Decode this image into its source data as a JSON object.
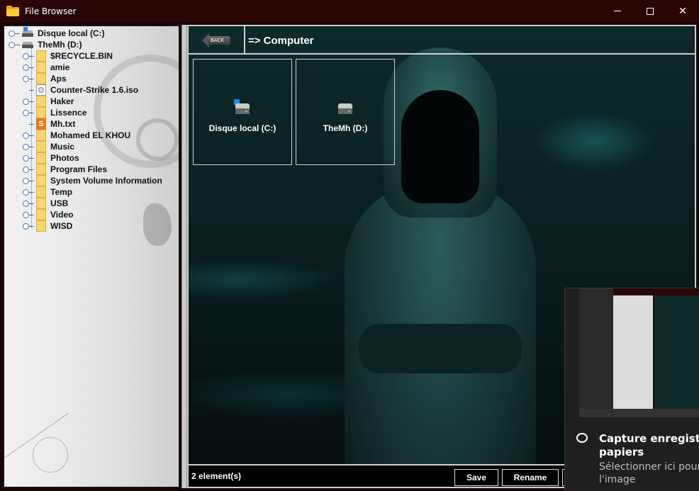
{
  "window": {
    "title": "File Browser",
    "minimize": "minimize",
    "maximize": "maximize",
    "close": "✕"
  },
  "tree": {
    "drives": [
      {
        "label": "Disque local (C:)"
      },
      {
        "label": "TheMh (D:)"
      }
    ],
    "children": [
      {
        "label": "$RECYCLE.BIN",
        "icon": "folder-icon"
      },
      {
        "label": "amie",
        "icon": "folder-icon"
      },
      {
        "label": "Aps",
        "icon": "folder-icon"
      },
      {
        "label": "Counter-Strike 1.6.iso",
        "icon": "iso-file-icon"
      },
      {
        "label": "Haker",
        "icon": "folder-icon"
      },
      {
        "label": "Lissence",
        "icon": "folder-icon"
      },
      {
        "label": "Mh.txt",
        "icon": "text-file-icon"
      },
      {
        "label": "Mohamed EL KHOU",
        "icon": "folder-icon"
      },
      {
        "label": "Music",
        "icon": "folder-icon"
      },
      {
        "label": "Photos",
        "icon": "folder-icon"
      },
      {
        "label": "Program Files",
        "icon": "folder-icon"
      },
      {
        "label": "System Volume Information",
        "icon": "folder-icon"
      },
      {
        "label": "Temp",
        "icon": "folder-icon"
      },
      {
        "label": "USB",
        "icon": "folder-icon"
      },
      {
        "label": "Video",
        "icon": "folder-icon"
      },
      {
        "label": "WISD",
        "icon": "folder-icon"
      }
    ]
  },
  "content": {
    "back_label": "BACK",
    "path": "=> Computer",
    "tiles": [
      {
        "label": "Disque local (C:)",
        "icon": "windows-drive-icon"
      },
      {
        "label": "TheMh (D:)",
        "icon": "drive-icon"
      }
    ],
    "status": "2 element(s)",
    "buttons": {
      "save": "Save",
      "rename": "Rename"
    }
  },
  "toast": {
    "title_line1": "Capture enregistrée d",
    "title_line2": "papiers",
    "sub_line1": "Sélectionner ici pour a",
    "sub_line2": "l'image"
  },
  "colors": {
    "titlebar": "#2b0606",
    "folder": "#f7d76b",
    "accent_text": "#ffffff"
  }
}
